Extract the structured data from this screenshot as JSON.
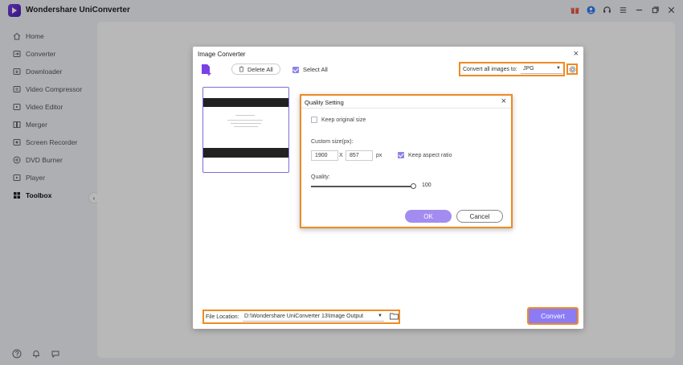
{
  "app": {
    "title": "Wondershare UniConverter"
  },
  "colors": {
    "accent": "#8b7cf6",
    "highlight": "#f08a24"
  },
  "sidebar": {
    "items": [
      {
        "label": "Home",
        "icon": "home-icon"
      },
      {
        "label": "Converter",
        "icon": "converter-icon"
      },
      {
        "label": "Downloader",
        "icon": "downloader-icon"
      },
      {
        "label": "Video Compressor",
        "icon": "compressor-icon"
      },
      {
        "label": "Video Editor",
        "icon": "editor-icon"
      },
      {
        "label": "Merger",
        "icon": "merger-icon"
      },
      {
        "label": "Screen Recorder",
        "icon": "recorder-icon"
      },
      {
        "label": "DVD Burner",
        "icon": "dvd-icon"
      },
      {
        "label": "Player",
        "icon": "player-icon"
      },
      {
        "label": "Toolbox",
        "icon": "toolbox-icon",
        "active": true
      }
    ]
  },
  "image_converter": {
    "title": "Image Converter",
    "delete_all": "Delete All",
    "select_all": "Select All",
    "select_all_checked": true,
    "convert_all_label": "Convert all images to:",
    "format": "JPG",
    "file_location_label": "File Location:",
    "file_location_path": "D:\\Wondershare UniConverter 13\\Image Output",
    "convert_button": "Convert"
  },
  "quality_setting": {
    "title": "Quality Setting",
    "keep_original_label": "Keep original size",
    "keep_original_checked": false,
    "custom_size_label": "Custom size(px):",
    "width": "1900",
    "x_sep": "X",
    "height": "857",
    "px_unit": "px",
    "keep_aspect_label": "Keep aspect ratio",
    "keep_aspect_checked": true,
    "quality_label": "Quality:",
    "quality_value": "100",
    "ok_button": "OK",
    "cancel_button": "Cancel"
  }
}
